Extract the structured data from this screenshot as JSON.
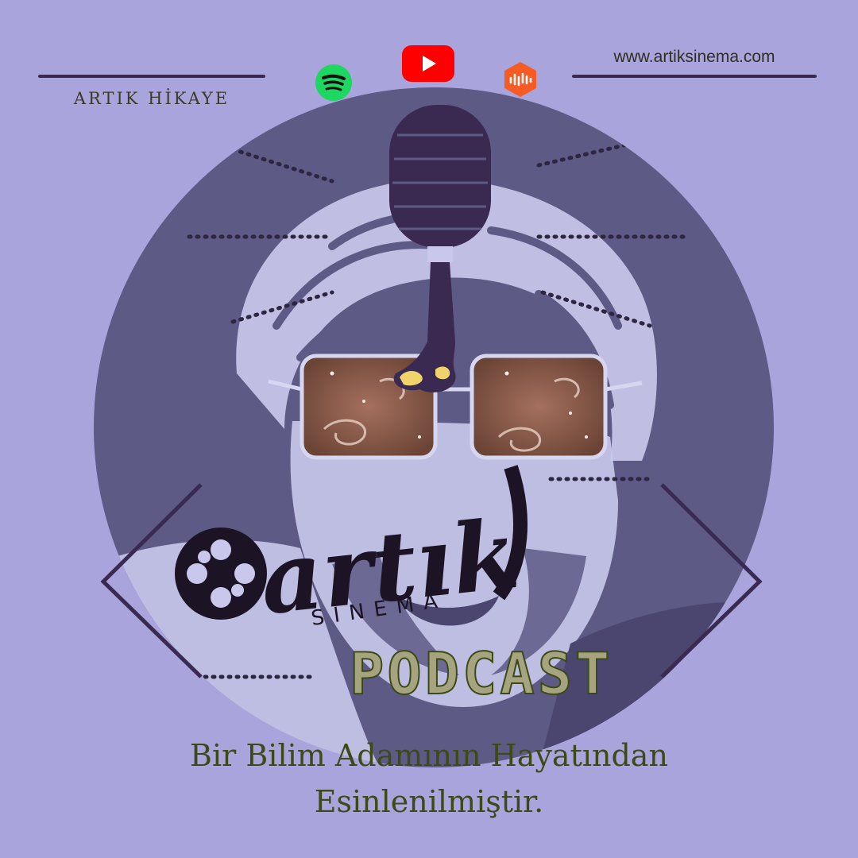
{
  "header": {
    "brand": "ARTIK HİKAYE",
    "website": "www.artiksinema.com"
  },
  "platforms": [
    {
      "name": "Spotify",
      "icon": "spotify-icon",
      "color": "#1ed760"
    },
    {
      "name": "YouTube",
      "icon": "youtube-icon",
      "color": "#ff0000"
    },
    {
      "name": "Castbox",
      "icon": "castbox-icon",
      "color": "#f55b23"
    }
  ],
  "logo": {
    "word": "artık",
    "sub": "SİNEMA"
  },
  "podcast_label": "PODCAST",
  "tagline": {
    "line1": "Bir Bilim Adamının Hayatından",
    "line2": "Esinlenilmiştir."
  },
  "colors": {
    "background": "#aaa4dc",
    "circle": "#5e5a86",
    "accent_dark": "#3a2a52",
    "text_olive": "#3c4a18"
  }
}
